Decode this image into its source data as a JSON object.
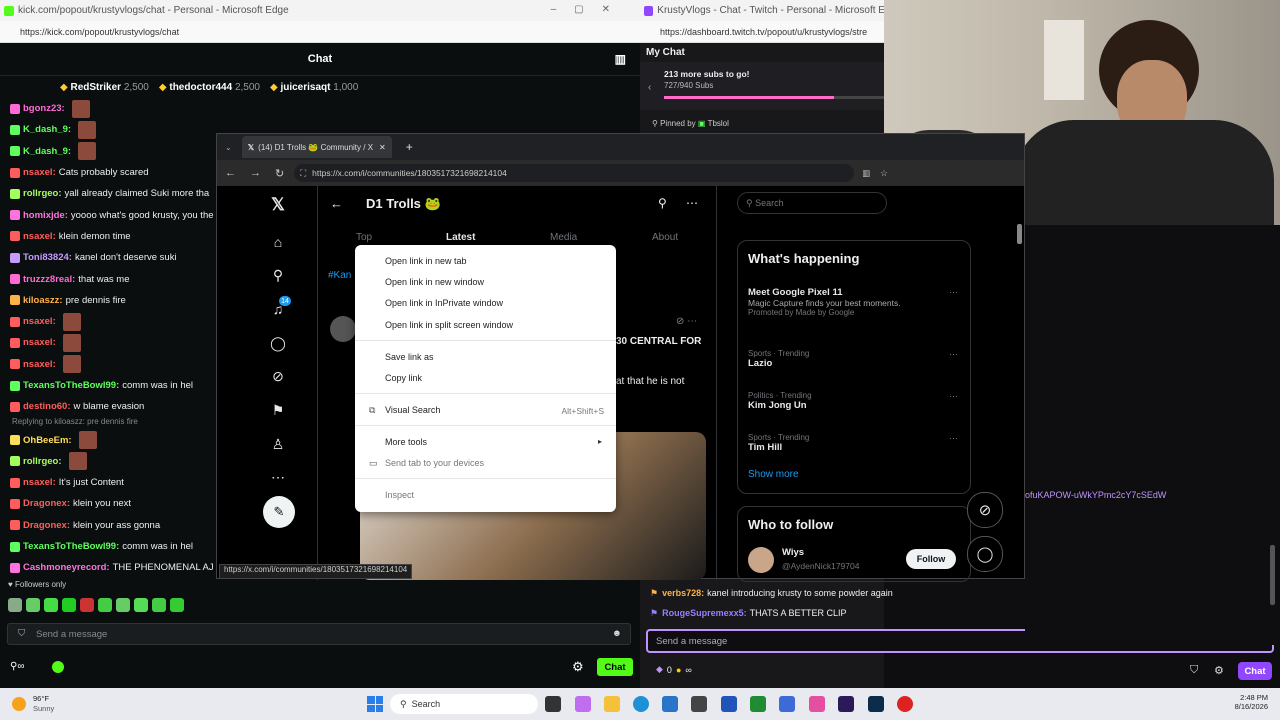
{
  "kick": {
    "window_title": "kick.com/popout/krustyvlogs/chat - Personal - Microsoft Edge",
    "url": "https://kick.com/popout/krustyvlogs/chat",
    "header_title": "Chat",
    "gifters": [
      {
        "name": "RedStriker",
        "amount": "2,500"
      },
      {
        "name": "thedoctor444",
        "amount": "2,500"
      },
      {
        "name": "juicerisaqt",
        "amount": "1,000"
      }
    ],
    "messages": [
      {
        "user": "bgonz23:",
        "text": "",
        "color": "#ff6ad5",
        "emote": true
      },
      {
        "user": "K_dash_9:",
        "text": "",
        "color": "#5eff5e",
        "emote": true
      },
      {
        "user": "K_dash_9:",
        "text": "",
        "color": "#5eff5e",
        "emote": true
      },
      {
        "user": "nsaxel:",
        "text": "Cats probably scared",
        "color": "#ff5d5d",
        "emote": false
      },
      {
        "user": "rollrgeo:",
        "text": "yall already claimed Suki more tha",
        "color": "#a3ff5c",
        "emote": false
      },
      {
        "user": "homixjde:",
        "text": "yoooo what's good krusty, you the g",
        "color": "#ff73e0",
        "emote": false
      },
      {
        "user": "nsaxel:",
        "text": "klein demon time",
        "color": "#ff5d5d",
        "emote": false
      },
      {
        "user": "Toni83824:",
        "text": "kanel don't deserve suki",
        "color": "#c59bff",
        "emote": false
      },
      {
        "user": "truzzz8real:",
        "text": "that was me",
        "color": "#ff6ad5",
        "emote": false
      },
      {
        "user": "kiloaszz:",
        "text": "pre dennis fire",
        "color": "#ffb347",
        "emote": false
      },
      {
        "user": "nsaxel:",
        "text": "",
        "color": "#ff5d5d",
        "emote": true
      },
      {
        "user": "nsaxel:",
        "text": "",
        "color": "#ff5d5d",
        "emote": true
      },
      {
        "user": "nsaxel:",
        "text": "",
        "color": "#ff5d5d",
        "emote": true
      },
      {
        "user": "TexansToTheBowl99:",
        "text": "comm was in hel",
        "color": "#5eff5e",
        "emote": false
      },
      {
        "user": "destino60:",
        "text": "w blame evasion",
        "color": "#ff5d5d",
        "emote": false
      }
    ],
    "reply_text": "Replying to kiloaszz: pre dennis fire",
    "messages2": [
      {
        "user": "OhBeeEm:",
        "text": "",
        "color": "#ffde59",
        "emote": true
      },
      {
        "user": "rollrgeo:",
        "text": "",
        "color": "#a3ff5c",
        "emote": true
      },
      {
        "user": "nsaxel:",
        "text": "It's just Content",
        "color": "#ff5d5d",
        "emote": false
      },
      {
        "user": "Dragonex:",
        "text": "klein you next",
        "color": "#ff5d5d",
        "emote": false
      },
      {
        "user": "Dragonex:",
        "text": "klein your ass gonna",
        "color": "#ff5d5d",
        "emote": false
      },
      {
        "user": "TexansToTheBowl99:",
        "text": "comm was in hel",
        "color": "#5eff5e",
        "emote": false
      },
      {
        "user": "Cashmoneyrecord:",
        "text": "THE PHENOMENAL AJ ST",
        "color": "#ff73e0",
        "emote": false
      }
    ],
    "followers_only": "Followers only",
    "send_placeholder": "Send a message",
    "chat_button": "Chat"
  },
  "twitch": {
    "window_title": "KrustyVlogs - Chat - Twitch - Personal - Microsoft Edge",
    "url": "https://dashboard.twitch.tv/popout/u/krustyvlogs/stre",
    "my_chat": "My Chat",
    "subs_goal": "213 more subs to go!",
    "subs_count": "727/940 Subs",
    "pinned_by": "Pinned by",
    "pinned_user": "Tbslol",
    "link_text": "ofuKAPOW-uWkYPmc2cY7cSEdW",
    "messages": [
      {
        "user": "verbs728:",
        "text": "kanel introducing krusty to some powder again",
        "color": "#ffb347"
      },
      {
        "user": "RougeSupremexx5:",
        "text": "THATS A BETTER CLIP",
        "color": "#9b7dff"
      }
    ],
    "send_placeholder": "Send a message",
    "points": "0",
    "chat_button": "Chat"
  },
  "xwin": {
    "tab_title": "(14) D1 Trolls 🐸 Community / X",
    "url": "https://x.com/i/communities/1803517321698214104",
    "community_title": "D1 Trolls 🐸",
    "tabs": [
      "Top",
      "Latest",
      "Media",
      "About"
    ],
    "search_placeholder": "Search",
    "notif_count": "14",
    "hashtag": "#Kan",
    "post_text1": "30 CENTRAL FOR",
    "post_text2": "at that he is not",
    "status_url": "https://x.com/i/communities/1803517321698214104",
    "whats_happening": "What's happening",
    "trends": [
      {
        "cat": "",
        "name": "Meet Google Pixel 11",
        "sub": "Magic Capture finds your best moments.",
        "promo": "Promoted by Made by Google"
      },
      {
        "cat": "Sports · Trending",
        "name": "Lazio"
      },
      {
        "cat": "Politics · Trending",
        "name": "Kim Jong Un"
      },
      {
        "cat": "Sports · Trending",
        "name": "Tim Hill"
      }
    ],
    "show_more": "Show more",
    "who_to_follow": "Who to follow",
    "follow_name": "Wiys",
    "follow_handle": "@AydenNick179704",
    "follow_button": "Follow"
  },
  "context_menu": {
    "items": [
      "Open link in new tab",
      "Open link in new window",
      "Open link in InPrivate window",
      "Open link in split screen window",
      "Save link as",
      "Copy link",
      "Visual Search",
      "More tools",
      "Send tab to your devices",
      "Inspect"
    ],
    "visual_search_shortcut": "Alt+Shift+S"
  },
  "taskbar": {
    "temp": "96°F",
    "weather": "Sunny",
    "search": "Search",
    "time": "2:48 PM",
    "date": "8/16/2026"
  }
}
